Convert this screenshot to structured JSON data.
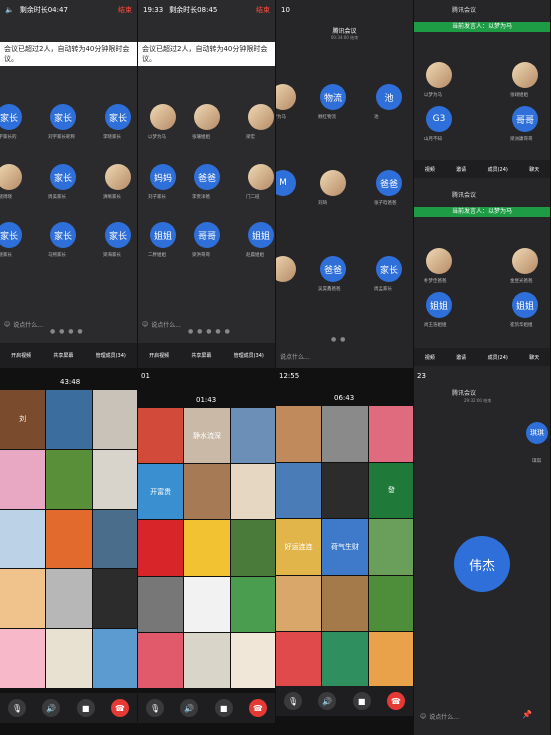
{
  "panel1": {
    "status_time": "剩余时长04:47",
    "status_right": "结束",
    "notice": "会议已超过2人，自动转为40分钟限时会议。",
    "avatars": [
      {
        "label": "家长",
        "name": "李宇家长的"
      },
      {
        "label": "家长",
        "name": "刘宇家长昵称"
      },
      {
        "label": "家长",
        "name": "李晓家长"
      },
      {
        "label": "",
        "name": "周晓周晓"
      },
      {
        "label": "家长",
        "name": "周美家长"
      },
      {
        "label": "",
        "name": "清晰家长"
      },
      {
        "label": "家长",
        "name": "陈晓家长"
      },
      {
        "label": "家长",
        "name": "马熙家长"
      },
      {
        "label": "家长",
        "name": "梁海家长"
      }
    ],
    "say": "说点什么...",
    "bottom": [
      "开启视频",
      "共享屏幕",
      "管理成员(34)",
      "更多"
    ]
  },
  "panel2": {
    "status_time": "19:33",
    "status_time2": "剩余时长08:45",
    "status_right": "结束",
    "notice": "会议已超过2人，自动转为40分钟限时会议。",
    "avatars": [
      {
        "label": "",
        "name": "以梦为马"
      },
      {
        "label": "",
        "name": "张珊姐姐"
      },
      {
        "label": "",
        "name": "梁宏"
      },
      {
        "label": "妈妈",
        "name": "刘子家长"
      },
      {
        "label": "爸爸",
        "name": "李贵洋爸"
      },
      {
        "label": "",
        "name": "门二班"
      },
      {
        "label": "姐姐",
        "name": "二胖姐姐"
      },
      {
        "label": "哥哥",
        "name": "梁洪哥哥"
      },
      {
        "label": "姐姐",
        "name": "赵晨姐姐"
      }
    ],
    "say": "说点什么...",
    "bottom": [
      "开启视频",
      "共享屏幕",
      "管理成员(34)"
    ]
  },
  "panel3": {
    "status_time": "10",
    "title": "腾讯会议",
    "subtitle": "00:34:00 结束",
    "avatars": [
      {
        "label": "",
        "name": "以梦为马"
      },
      {
        "label": "物流",
        "name": "顾红物流"
      },
      {
        "label": "池",
        "name": "池"
      },
      {
        "label": "M",
        "name": ""
      },
      {
        "label": "",
        "name": "刘琦"
      },
      {
        "label": "爸爸",
        "name": "张子晗爸爸"
      },
      {
        "label": "",
        "name": ""
      },
      {
        "label": "爸爸",
        "name": "吴昊鑫爸爸"
      },
      {
        "label": "家长",
        "name": "周孟家长"
      }
    ],
    "say": "说点什么..."
  },
  "panel4": {
    "title": "腾讯会议",
    "speaker": "当前发言人：以梦为马",
    "title2": "腾讯会议",
    "speaker2": "当前发言人：以梦为马",
    "avatars": [
      {
        "label": "",
        "name": "以梦为马"
      },
      {
        "label": "",
        "name": "张翊姐姐"
      },
      {
        "label": "G3",
        "name": "山月不知"
      },
      {
        "label": "哥哥",
        "name": "梁洲康哥哥"
      }
    ],
    "avatars2": [
      {
        "label": "",
        "name": "朴梦佳爸爸"
      },
      {
        "label": "",
        "name": "金昱光爸爸"
      },
      {
        "label": "姐姐",
        "name": "尚王浩姐姐"
      },
      {
        "label": "姐姐",
        "name": "崔凯华姐姐"
      }
    ],
    "bottom": [
      "视频",
      "邀请",
      "成员(24)",
      "聊天"
    ]
  },
  "gallery1": {
    "time": "43:48",
    "tiles": [
      "刘",
      "",
      "",
      "",
      "",
      "",
      "",
      "",
      "",
      "",
      "",
      "",
      "",
      "",
      ""
    ]
  },
  "gallery2": {
    "status": "01",
    "time": "01:43",
    "tiles": [
      "",
      "静水流深",
      "",
      "开富贵",
      "",
      "",
      "",
      "",
      "",
      "",
      "",
      "",
      "",
      "",
      ""
    ]
  },
  "gallery3": {
    "status": "12:55",
    "time": "06:43",
    "tiles": [
      "",
      "",
      "",
      "",
      "",
      "發",
      "好运连连",
      "荷气生财",
      "",
      "",
      "",
      "",
      "",
      "",
      ""
    ]
  },
  "panel_right": {
    "status": "23",
    "title": "腾讯会议",
    "subtitle": "29:32:00 结束",
    "big": "伟杰",
    "small": "琪琪",
    "small_name": "琪琪",
    "say": "说点什么..."
  },
  "icons": [
    "mic-icon",
    "speaker-icon",
    "camera-icon",
    "hangup-icon",
    "chat-icon",
    "pin-icon"
  ]
}
